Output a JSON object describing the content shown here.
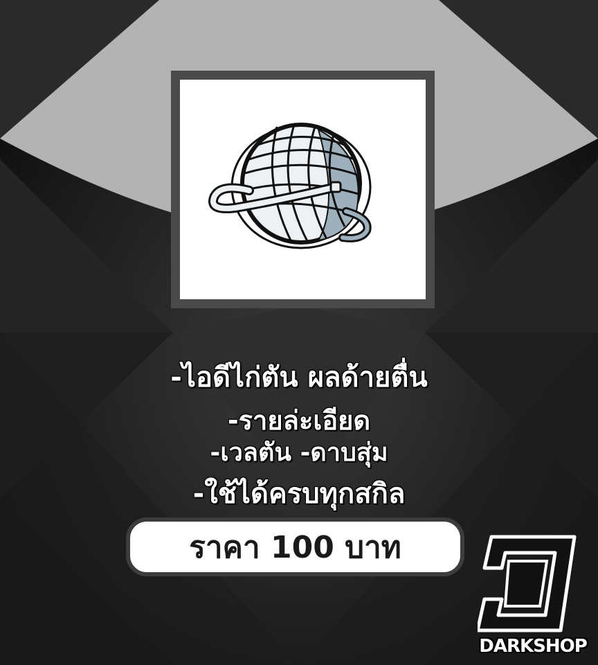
{
  "product": {
    "title_part1": "-ไอดีไก่ตัน",
    "title_part2": "ผลด้ายตื่น",
    "line2": "-รายล่ะเอียด",
    "line3": "-เวลตัน -ดาบสุ่ม",
    "line4": "-ใช้ได้ครบทุกสกิล",
    "price": "ราคา 100 บาท",
    "image_icon": "yarn-ball-icon"
  },
  "brand": {
    "name": "DARKSHOP",
    "logo_icon": "d-logo-icon"
  },
  "colors": {
    "background": "#1a1a1a",
    "arc": "#b3b3b3",
    "frame": "#4a4a4a",
    "text": "#ffffff",
    "price_bg": "#ffffff",
    "yarn_accent": "#9fb0bd"
  }
}
